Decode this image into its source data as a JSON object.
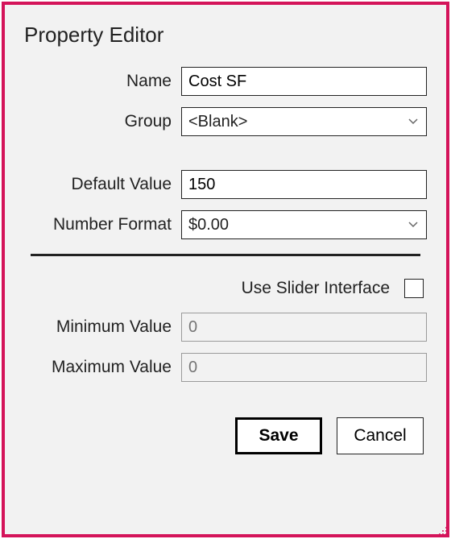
{
  "dialog": {
    "title": "Property Editor"
  },
  "fields": {
    "name": {
      "label": "Name",
      "value": "Cost SF"
    },
    "group": {
      "label": "Group",
      "value": "<Blank>"
    },
    "defaultValue": {
      "label": "Default Value",
      "value": "150"
    },
    "numberFormat": {
      "label": "Number Format",
      "value": "$0.00"
    },
    "useSlider": {
      "label": "Use Slider Interface",
      "checked": false
    },
    "minValue": {
      "label": "Minimum Value",
      "placeholder": "0",
      "value": ""
    },
    "maxValue": {
      "label": "Maximum Value",
      "placeholder": "0",
      "value": ""
    }
  },
  "buttons": {
    "save": "Save",
    "cancel": "Cancel"
  }
}
